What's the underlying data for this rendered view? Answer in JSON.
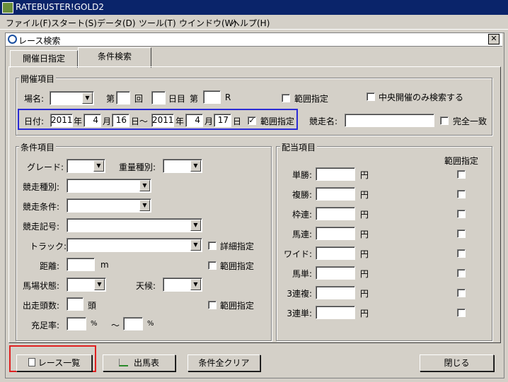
{
  "app": {
    "title": "RATEBUSTER!GOLD2"
  },
  "menu": [
    "ファイル(F)",
    "スタート(S)",
    "データ(D)",
    "ツール(T)",
    "ウインドウ(W)",
    "ヘルプ(H)"
  ],
  "child": {
    "title": "レース検索",
    "close": "✕"
  },
  "tabs": [
    {
      "label": "開催日指定"
    },
    {
      "label": "条件検索"
    }
  ],
  "kaisai": {
    "legend": "開催項目",
    "place_label": "場名:",
    "dai": "第",
    "kai": "回",
    "nichime": "日目",
    "dai2": "第",
    "race": "R",
    "range_label": "範囲指定",
    "central_only_label": "中央開催のみ検索する",
    "date_label": "日付:",
    "from": {
      "year": "2011",
      "month": "4",
      "day": "16"
    },
    "to": {
      "year": "2011",
      "month": "4",
      "day": "17"
    },
    "nen": "年",
    "gatsu": "月",
    "nichi": "日〜",
    "nichi_end": "日",
    "date_range_label": "範囲指定",
    "race_name_label": "競走名:",
    "exact_match_label": "完全一致"
  },
  "conditions": {
    "legend": "条件項目",
    "grade": "グレード:",
    "weight_type": "重量種別:",
    "race_type": "競走種別:",
    "race_cond": "競走条件:",
    "race_sign": "競走記号:",
    "track": "トラック:",
    "detail_label": "詳細指定",
    "distance": "距離:",
    "m": "m",
    "range_label": "範囲指定",
    "going": "馬場状態:",
    "weather": "天候:",
    "runners": "出走頭数:",
    "tou": "頭",
    "fill_rate": "充足率:",
    "percent": "%",
    "tilde": "〜"
  },
  "payout": {
    "legend": "配当項目",
    "range_header": "範囲指定",
    "yen": "円",
    "items": [
      "単勝:",
      "複勝:",
      "枠連:",
      "馬連:",
      "ワイド:",
      "馬単:",
      "3連複:",
      "3連単:"
    ]
  },
  "buttons": {
    "race_list": "レース一覧",
    "entries": "出馬表",
    "clear_all": "条件全クリア",
    "close": "閉じる"
  }
}
